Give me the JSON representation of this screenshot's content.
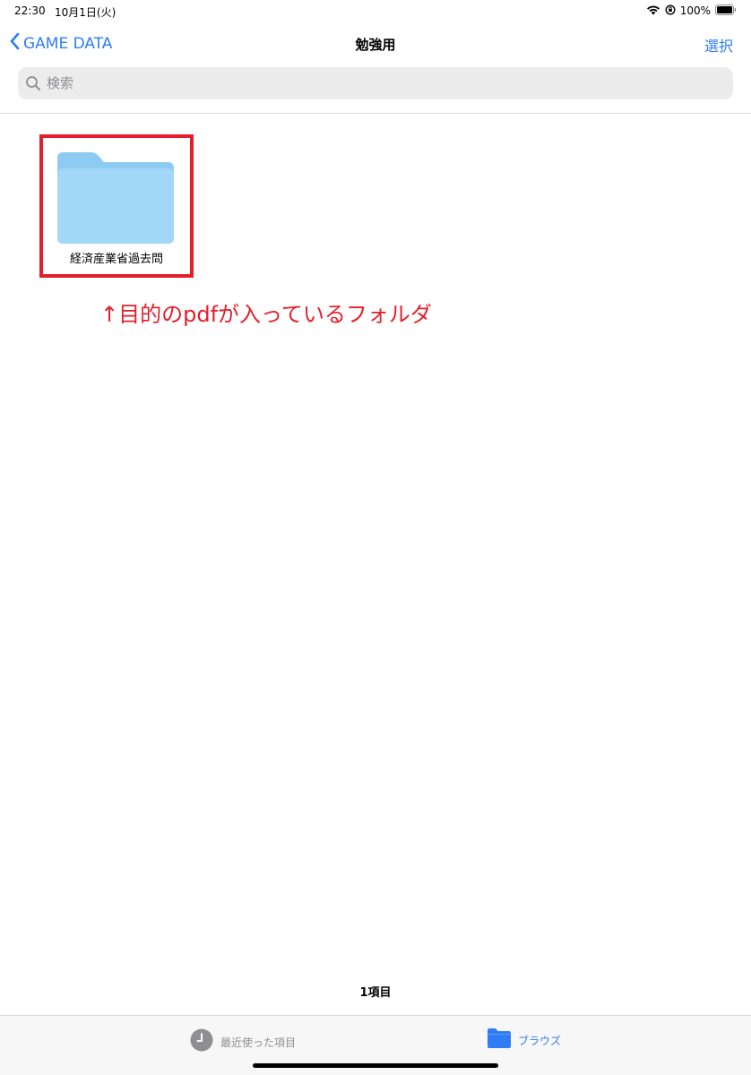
{
  "status_bar": {
    "time": "22:30",
    "date": "10月1日(火)",
    "battery": "100%"
  },
  "nav": {
    "back_label": "GAME DATA",
    "title": "勉強用",
    "select_label": "選択"
  },
  "search": {
    "placeholder": "検索"
  },
  "folder": {
    "name": "経済産業省過去問"
  },
  "annotation": "↑目的のpdfが入っているフォルダ",
  "item_count": "1項目",
  "tabs": {
    "recents": "最近使った項目",
    "browse": "ブラウズ"
  },
  "colors": {
    "accent": "#2f7cf6",
    "highlight": "#e41e2a",
    "folder": "#9fd4f5"
  },
  "icons": {
    "back": "chevron-left-icon",
    "search": "search-icon",
    "folder": "folder-icon",
    "recents": "clock-icon",
    "browse": "folder-icon",
    "wifi": "wifi-icon",
    "rotation_lock": "rotation-lock-icon",
    "battery": "battery-icon"
  }
}
